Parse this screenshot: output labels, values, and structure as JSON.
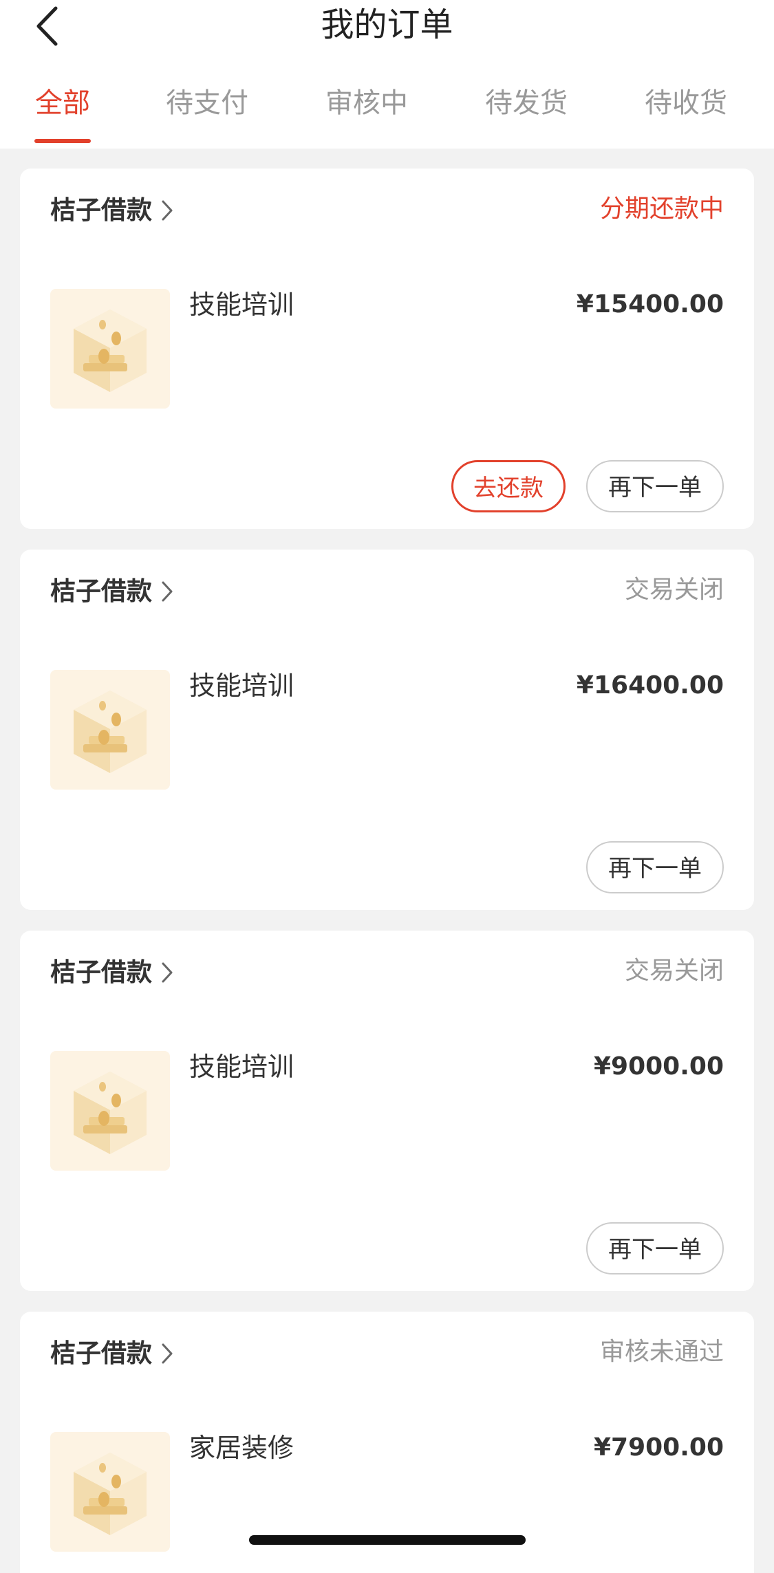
{
  "header": {
    "title": "我的订单",
    "back_icon": "chevron-left-icon"
  },
  "tabs": [
    {
      "label": "全部",
      "active": true
    },
    {
      "label": "待支付",
      "active": false
    },
    {
      "label": "审核中",
      "active": false
    },
    {
      "label": "待发货",
      "active": false
    },
    {
      "label": "待收货",
      "active": false
    }
  ],
  "orders": [
    {
      "shop": "桔子借款",
      "status": "分期还款中",
      "product": "技能培训",
      "price": "¥15400.00",
      "repay_label": "去还款",
      "reorder_label": "再下一单"
    },
    {
      "shop": "桔子借款",
      "status": "交易关闭",
      "product": "技能培训",
      "price": "¥16400.00",
      "reorder_label": "再下一单"
    },
    {
      "shop": "桔子借款",
      "status": "交易关闭",
      "product": "技能培训",
      "price": "¥9000.00",
      "reorder_label": "再下一单"
    },
    {
      "shop": "桔子借款",
      "status": "审核未通过",
      "product": "家居装修",
      "price": "¥7900.00"
    }
  ],
  "colors": {
    "accent": "#e2412c",
    "muted": "#999999",
    "text": "#333333",
    "background": "#f2f2f2",
    "thumbnail_bg": "#fdf3e3"
  },
  "icons": {
    "shop_chevron": "chevron-right-icon",
    "product_thumbnail": "gold-coins-cube-icon"
  }
}
